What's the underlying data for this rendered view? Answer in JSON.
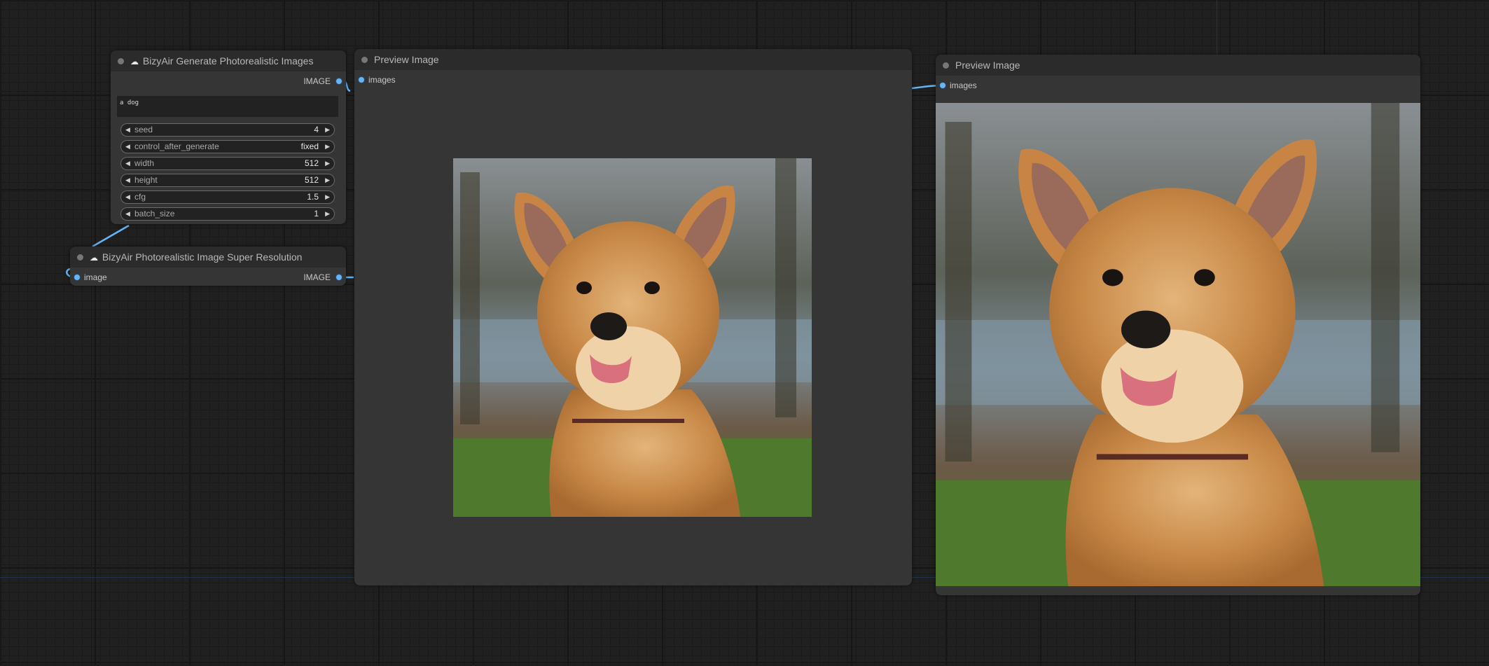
{
  "nodes": {
    "generate": {
      "title": "BizyAir Generate Photorealistic Images",
      "output_label": "IMAGE",
      "prompt_text": "a dog",
      "widgets": [
        {
          "label": "seed",
          "value": "4"
        },
        {
          "label": "control_after_generate",
          "value": "fixed"
        },
        {
          "label": "width",
          "value": "512"
        },
        {
          "label": "height",
          "value": "512"
        },
        {
          "label": "cfg",
          "value": "1.5"
        },
        {
          "label": "batch_size",
          "value": "1"
        }
      ]
    },
    "super_resolution": {
      "title": "BizyAir Photorealistic Image Super Resolution",
      "input_label": "image",
      "output_label": "IMAGE"
    },
    "preview1": {
      "title": "Preview Image",
      "input_label": "images",
      "image": "dog-photo"
    },
    "preview2": {
      "title": "Preview Image",
      "input_label": "images",
      "image": "dog-photo-upscaled"
    }
  },
  "icons": {
    "cloud": "cloud-icon",
    "arrow_left": "triangle-left-icon",
    "arrow_right": "triangle-right-icon"
  },
  "colors": {
    "link": "#64b5f6",
    "canvas": "#202020",
    "node_body": "#353535",
    "node_title": "#2b2b2b"
  }
}
